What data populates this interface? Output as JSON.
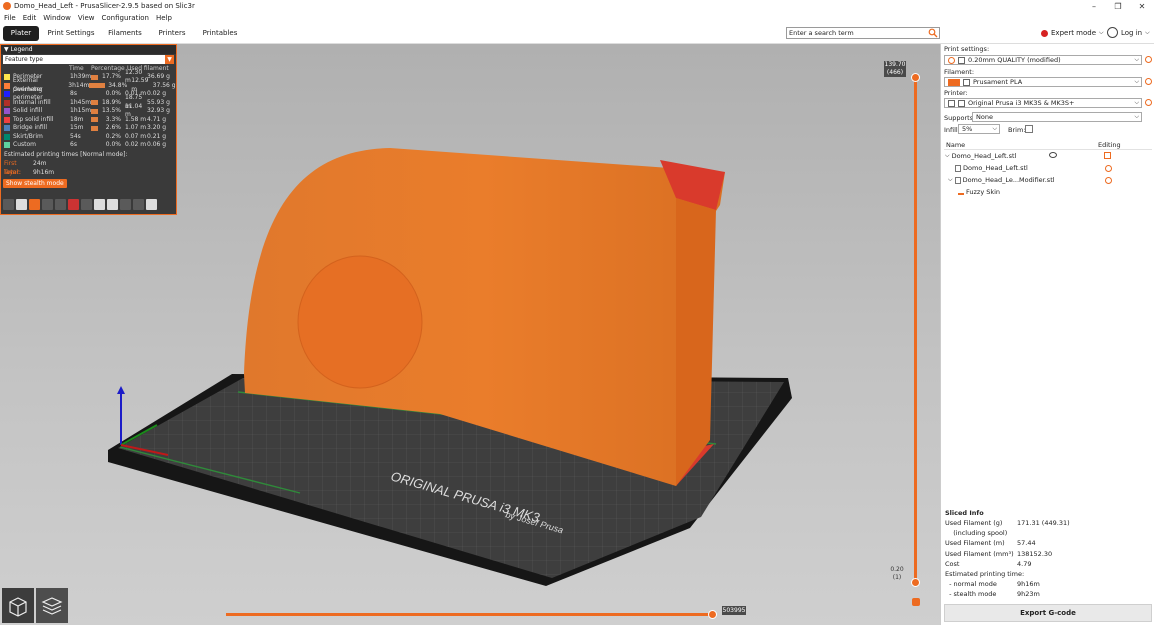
{
  "window": {
    "title": "Domo_Head_Left - PrusaSlicer-2.9.5 based on Slic3r",
    "minimize": "–",
    "maximize": "❐",
    "close": "✕"
  },
  "menu": [
    "File",
    "Edit",
    "Window",
    "View",
    "Configuration",
    "Help"
  ],
  "tabs": [
    {
      "label": "Plater",
      "active": true
    },
    {
      "label": "Print Settings",
      "active": false
    },
    {
      "label": "Filaments",
      "active": false
    },
    {
      "label": "Printers",
      "active": false
    },
    {
      "label": "Printables",
      "active": false
    }
  ],
  "search": {
    "placeholder": "Enter a search term"
  },
  "mode": {
    "label": "Expert mode",
    "color": "#d62222"
  },
  "login": {
    "label": "Log in"
  },
  "legend": {
    "title": "Legend",
    "feature_type": "Feature type",
    "columns": {
      "time": "Time",
      "percentage": "Percentage",
      "used": "Used filament"
    },
    "rows": [
      {
        "name": "Perimeter",
        "color": "#ffe64d",
        "time": "1h39m",
        "pct": "17.7%",
        "len": "12.30 m",
        "wt": "36.69 g"
      },
      {
        "name": "External perimeter",
        "color": "#ff7d38",
        "time": "3h14m",
        "pct": "34.8%",
        "len": "12.59 m",
        "wt": "37.56 g"
      },
      {
        "name": "Overhang perimeter",
        "color": "#1f1fff",
        "time": "8s",
        "pct": "0.0%",
        "len": "0.01 m",
        "wt": "0.02 g"
      },
      {
        "name": "Internal infill",
        "color": "#b03029",
        "time": "1h45m",
        "pct": "18.9%",
        "len": "18.75 m",
        "wt": "55.93 g"
      },
      {
        "name": "Solid infill",
        "color": "#9654cc",
        "time": "1h15m",
        "pct": "13.5%",
        "len": "11.04 m",
        "wt": "32.93 g"
      },
      {
        "name": "Top solid infill",
        "color": "#f04040",
        "time": "18m",
        "pct": "3.3%",
        "len": "1.58 m",
        "wt": "4.71 g"
      },
      {
        "name": "Bridge infill",
        "color": "#4d80ba",
        "time": "15m",
        "pct": "2.6%",
        "len": "1.07 m",
        "wt": "3.20 g"
      },
      {
        "name": "Skirt/Brim",
        "color": "#00876e",
        "time": "54s",
        "pct": "0.2%",
        "len": "0.07 m",
        "wt": "0.21 g"
      },
      {
        "name": "Custom",
        "color": "#5ed1a0",
        "time": "6s",
        "pct": "0.0%",
        "len": "0.02 m",
        "wt": "0.06 g"
      }
    ],
    "est_title": "Estimated printing times [Normal mode]:",
    "first_layer_label": "First layer:",
    "first_layer": "24m",
    "total_label": "Total:",
    "total": "9h16m",
    "stealth_button": "Show stealth mode"
  },
  "vertical_slider": {
    "top": "139.70",
    "top_layer": "(466)",
    "bottom": "0.20",
    "bottom_layer": "(1)"
  },
  "horizontal_slider": {
    "value": "503995"
  },
  "bed_text": {
    "line1": "ORIGINAL PRUSA i3 MK3",
    "line2": "by Josef Prusa"
  },
  "right_panel": {
    "print_settings_label": "Print settings:",
    "print_settings_value": "0.20mm QUALITY (modified)",
    "filament_label": "Filament:",
    "filament_value": "Prusament PLA",
    "filament_color": "#ed6b21",
    "printer_label": "Printer:",
    "printer_value": "Original Prusa i3 MK3S & MK3S+",
    "supports_label": "Supports:",
    "supports_value": "None",
    "infill_label": "Infill:",
    "infill_value": "5%",
    "brim_label": "Brim:",
    "tree_name_header": "Name",
    "tree_editing_header": "Editing",
    "tree": {
      "root": "Domo_Head_Left.stl",
      "child1": "Domo_Head_Left.stl",
      "child2": "Domo_Head_Le...Modifier.stl",
      "child3": "Fuzzy Skin"
    },
    "sliced_info": {
      "title": "Sliced Info",
      "rows": [
        {
          "k": "Used Filament (g)",
          "v": "171.31 (449.31)"
        },
        {
          "k": "    (including spool)",
          "v": ""
        },
        {
          "k": "Used Filament (m)",
          "v": "57.44"
        },
        {
          "k": "Used Filament (mm³)",
          "v": "138152.30"
        },
        {
          "k": "Cost",
          "v": "4.79"
        },
        {
          "k": "Estimated printing time:",
          "v": ""
        },
        {
          "k": "  - normal mode",
          "v": "9h16m"
        },
        {
          "k": "  - stealth mode",
          "v": "9h23m"
        }
      ]
    },
    "export_button": "Export G-code"
  }
}
